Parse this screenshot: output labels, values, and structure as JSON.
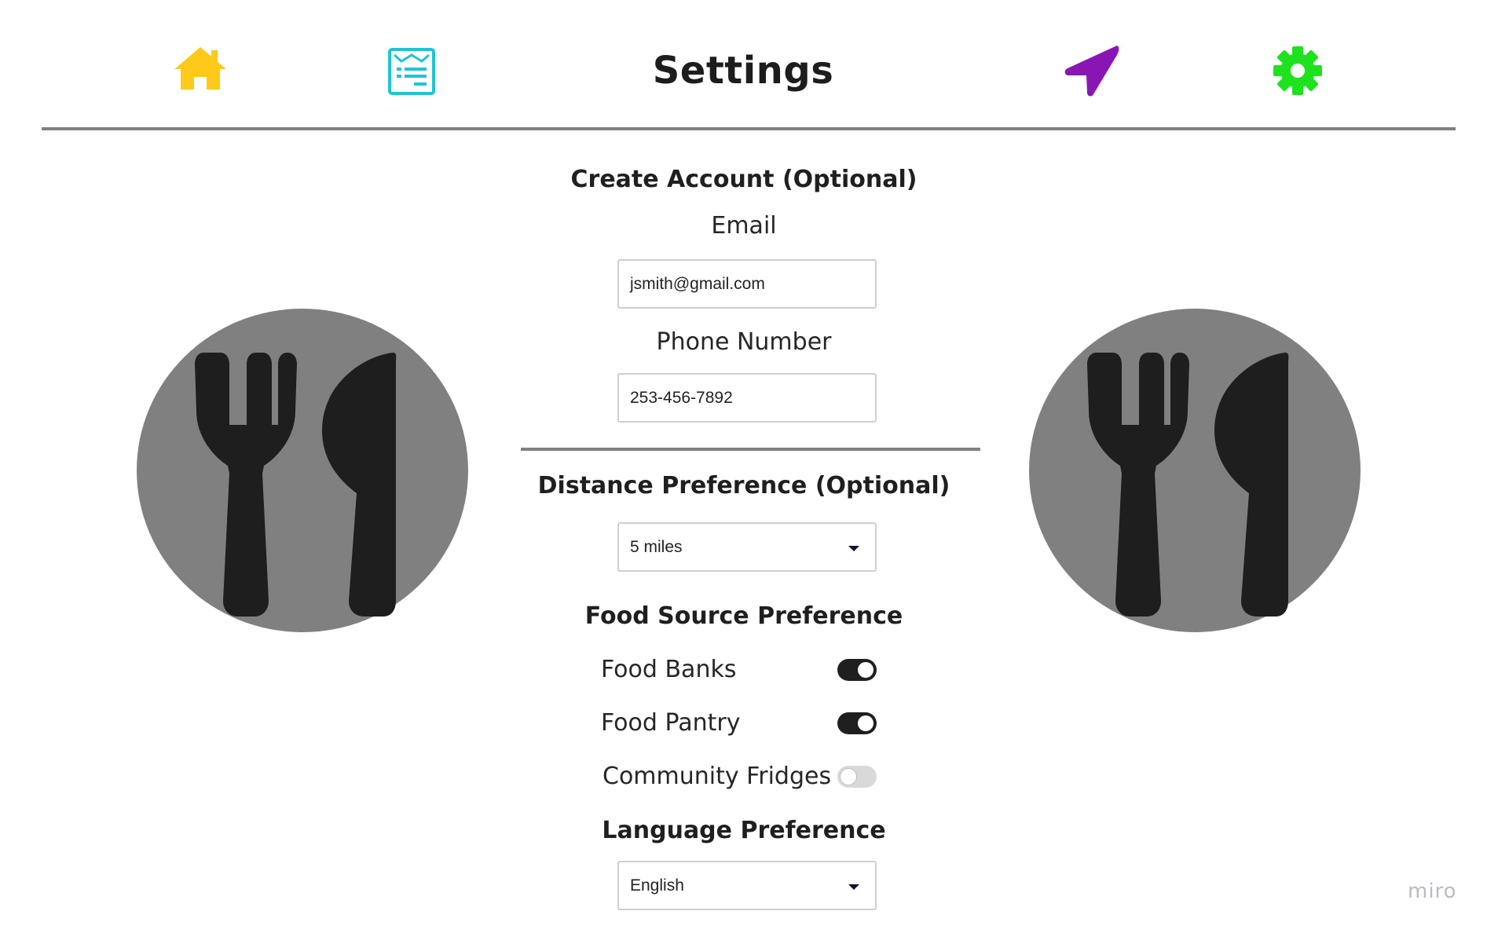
{
  "header": {
    "title": "Settings",
    "icons": {
      "home": "home-icon",
      "list": "list-icon",
      "navigate": "navigation-arrow-icon",
      "settings": "gear-icon"
    },
    "colors": {
      "home": "#ffc91a",
      "list": "#20c4d4",
      "navigate": "#8a15b5",
      "settings": "#1fe21f"
    }
  },
  "account": {
    "title": "Create Account (Optional)",
    "email_label": "Email",
    "email_value": "jsmith@gmail.com",
    "phone_label": "Phone Number",
    "phone_value": "253-456-7892"
  },
  "distance": {
    "title": "Distance Preference (Optional)",
    "selected": "5 miles"
  },
  "food_source": {
    "title": "Food Source Preference",
    "options": [
      {
        "label": "Food Banks",
        "on": true
      },
      {
        "label": "Food Pantry",
        "on": true
      },
      {
        "label": "Community Fridges",
        "on": false
      }
    ]
  },
  "language": {
    "title": "Language Preference",
    "selected": "English"
  },
  "decor": {
    "left_icon": "fork-knife-icon",
    "right_icon": "fork-knife-icon",
    "plate_color": "#808080"
  },
  "watermark": "miro"
}
